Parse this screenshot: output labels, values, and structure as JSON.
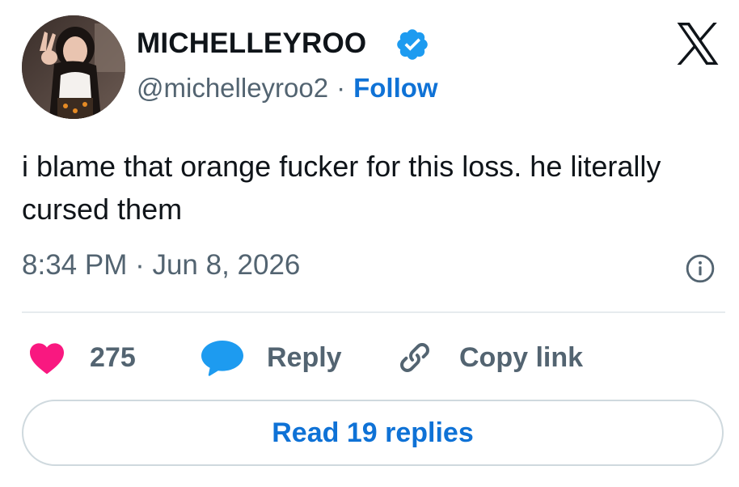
{
  "author": {
    "display_name": "MICHELLEYROO",
    "handle": "@michelleyroo2",
    "separator": "·",
    "follow_label": "Follow",
    "verified": true
  },
  "tweet": {
    "text": "i blame that orange fucker for this loss. he literally cursed them",
    "timestamp": "8:34 PM · Jun 8, 2026"
  },
  "actions": {
    "like_count": "275",
    "reply_label": "Reply",
    "copy_link_label": "Copy link"
  },
  "read_replies_label": "Read 19 replies",
  "colors": {
    "accent": "#0f72d6",
    "like": "#f91880",
    "reply_icon": "#1d9bf0",
    "muted": "#536471",
    "verified_badge": "#1d9bf0"
  },
  "icons": {
    "platform": "x-logo-icon",
    "verified": "verified-badge-icon",
    "info": "info-icon",
    "like": "heart-icon",
    "reply": "speech-bubble-icon",
    "copy": "link-icon"
  }
}
